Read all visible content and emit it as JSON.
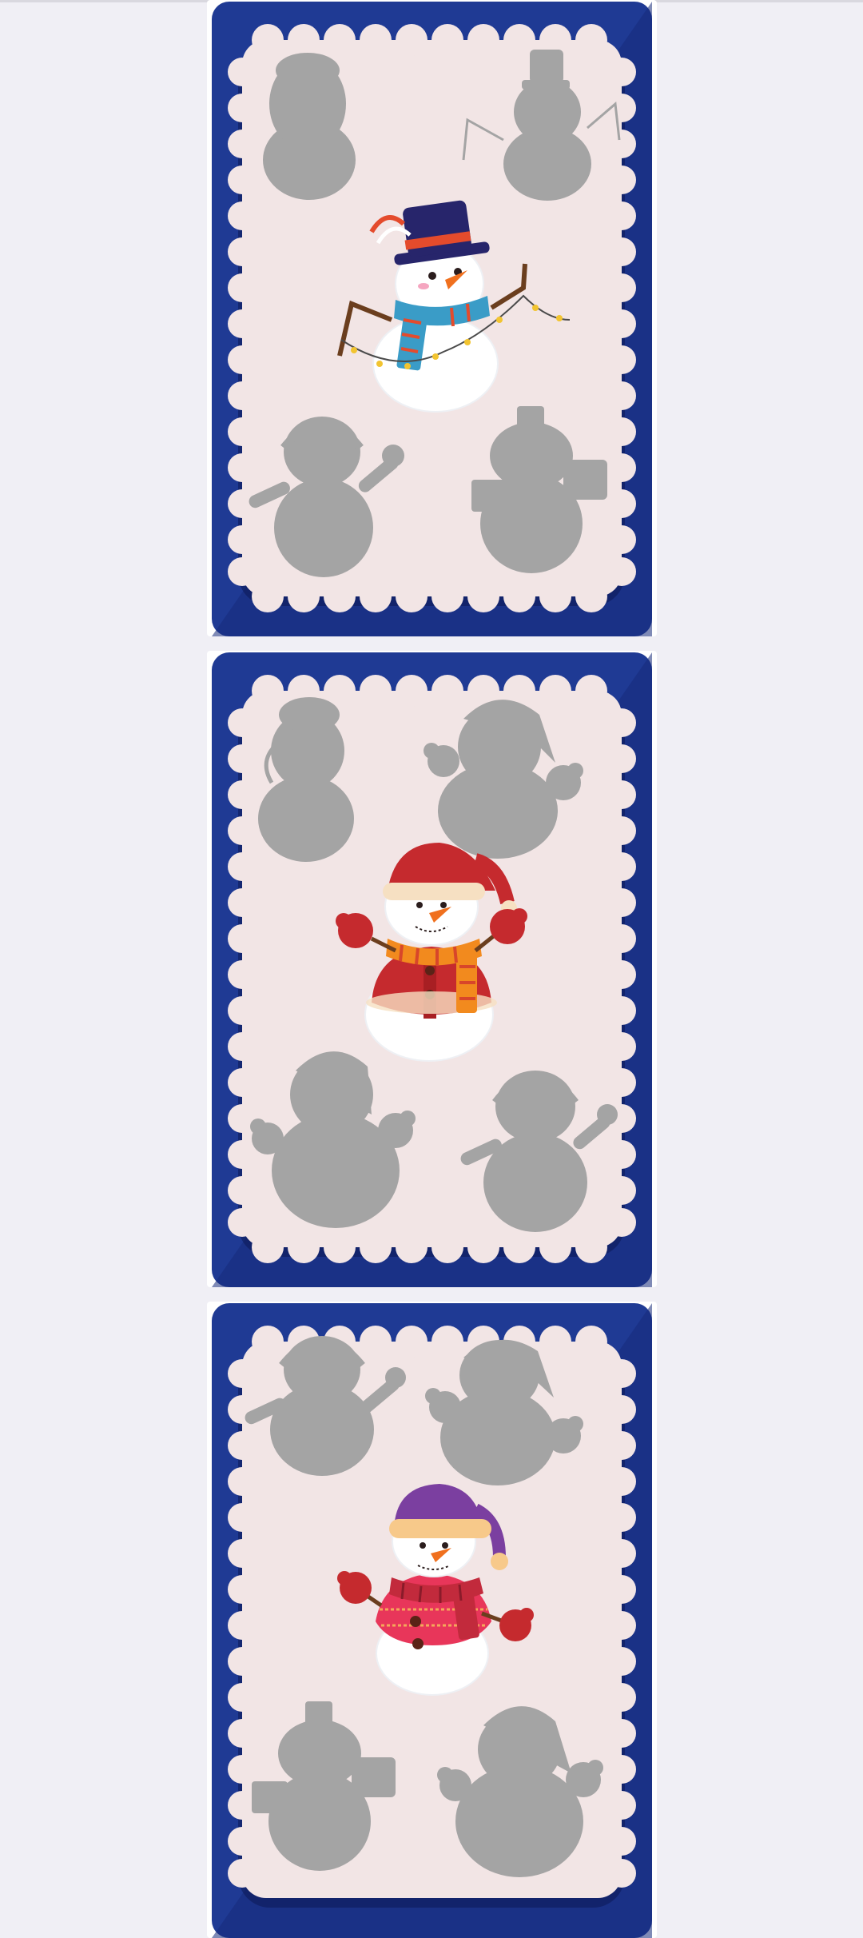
{
  "feed": {
    "cards": [
      {
        "id_label": "card-1",
        "colors": {
          "frame": "#1f3a94",
          "frame_dark": "#16297a",
          "paper": "#f2e5e5",
          "silhouette": "#a4a4a4"
        },
        "silhouettes": [
          "snowman-bobble-hat",
          "snowman-top-hat-lights",
          "snowman-earmuffs-waving",
          "snowman-top-hat-gifts"
        ],
        "featured": {
          "icon": "snowman-top-hat-scarf-lights",
          "hat": "#27256b",
          "scarf": "#3a9cc7",
          "accent": "#e44b2c"
        }
      },
      {
        "id_label": "card-2",
        "colors": {
          "frame": "#1f3a94",
          "frame_dark": "#16297a",
          "paper": "#f2e5e5",
          "silhouette": "#a4a4a4"
        },
        "silhouettes": [
          "snowman-bobble-hat",
          "snowman-santa-mittens",
          "snowman-santa-mittens",
          "snowman-earmuffs-waving"
        ],
        "featured": {
          "icon": "snowman-santa-coat",
          "hat": "#c52a2e",
          "scarf": "#f28a1e",
          "accent": "#c52a2e"
        }
      },
      {
        "id_label": "card-3",
        "colors": {
          "frame": "#1f3a94",
          "frame_dark": "#16297a",
          "paper": "#f2e5e5",
          "silhouette": "#a4a4a4"
        },
        "silhouettes": [
          "snowman-earmuffs-waving",
          "snowman-santa-mittens",
          "snowman-top-hat-gifts",
          "snowman-santa-mittens"
        ],
        "featured": {
          "icon": "snowman-purple-hat-sweater",
          "hat": "#7b3fa0",
          "scarf": "#c22a3c",
          "accent": "#e8365a"
        }
      }
    ]
  }
}
